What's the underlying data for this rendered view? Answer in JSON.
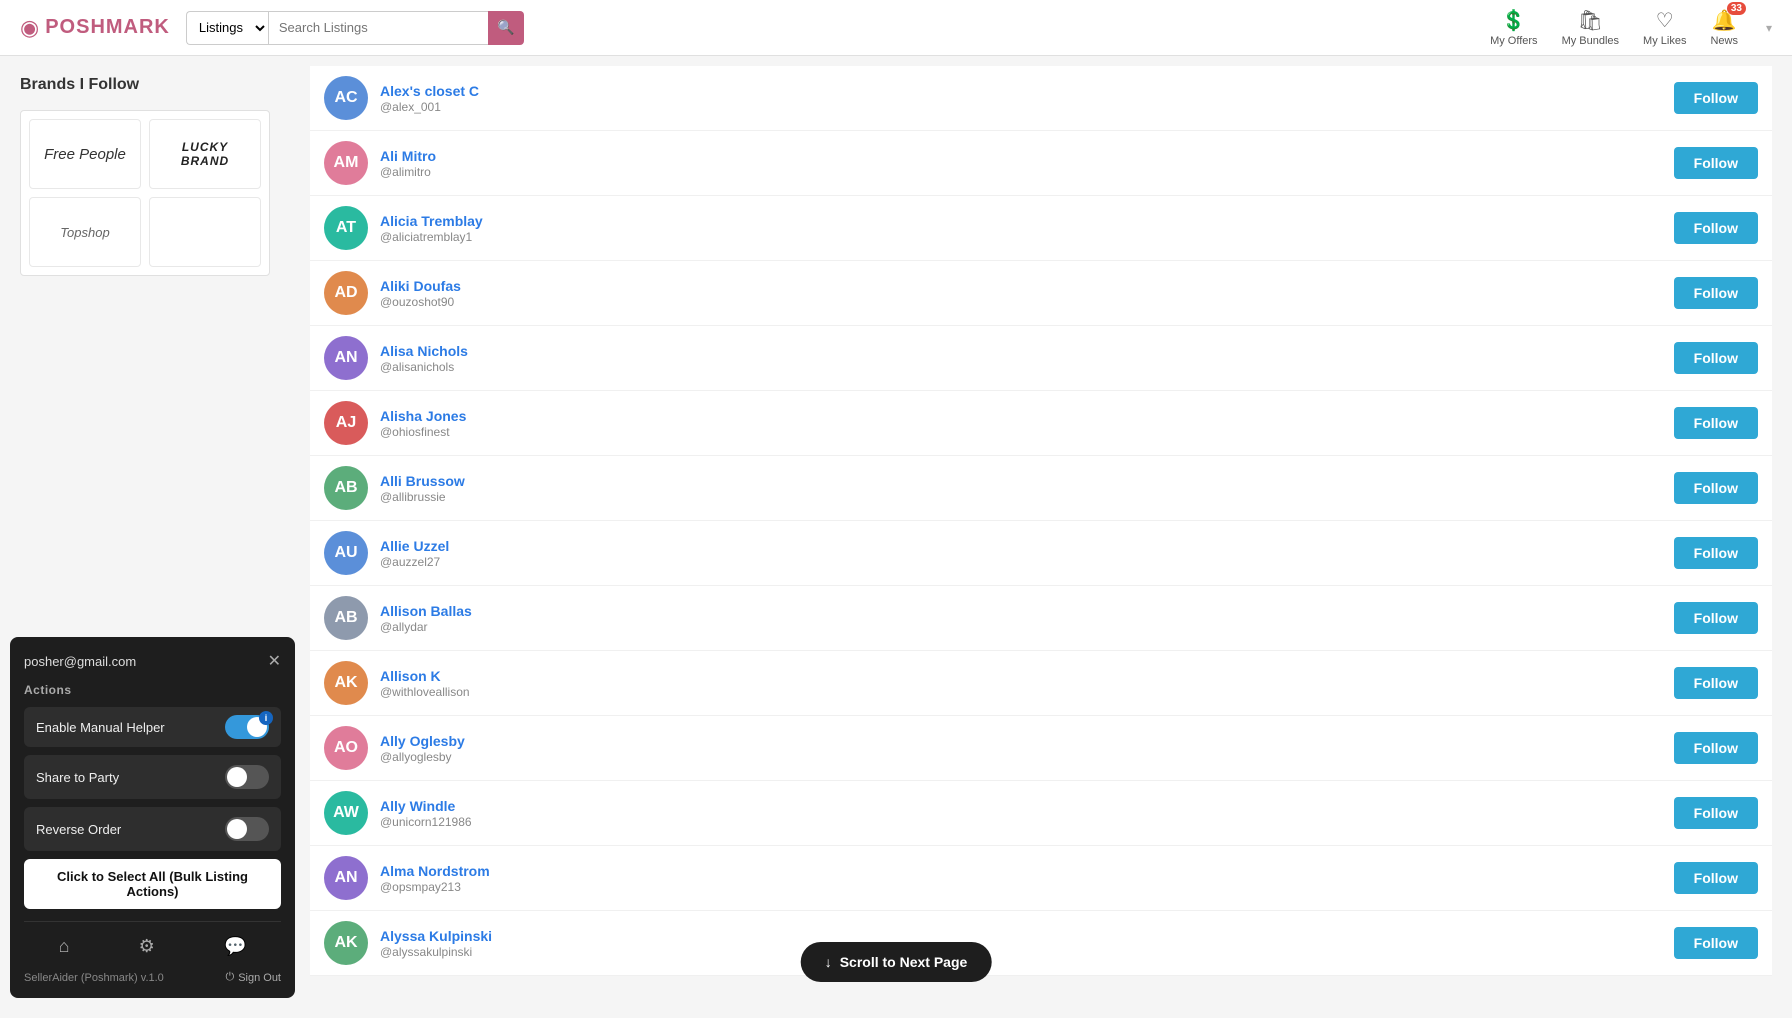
{
  "header": {
    "logo_text": "POSHMARK",
    "search_placeholder": "Search Listings",
    "search_dropdown": "Listings",
    "nav_items": [
      {
        "id": "my-offers",
        "icon": "💲",
        "label": "My Offers",
        "badge": null
      },
      {
        "id": "my-bundles",
        "icon": "🛍",
        "label": "My Bundles",
        "badge": null
      },
      {
        "id": "my-likes",
        "icon": "♡",
        "label": "My Likes",
        "badge": null
      },
      {
        "id": "news",
        "icon": "🔔",
        "label": "News",
        "badge": "33"
      }
    ]
  },
  "sidebar": {
    "title": "Brands I Follow",
    "brands": [
      {
        "id": "free-people",
        "name": "Free People",
        "style": "italic"
      },
      {
        "id": "lucky-brand",
        "name": "LUCKY\nBRAND",
        "style": "bold"
      },
      {
        "id": "topshop",
        "name": "Topshop",
        "style": "normal"
      },
      {
        "id": "empty",
        "name": "",
        "style": "empty"
      }
    ]
  },
  "widget": {
    "email": "posher@gmail.com",
    "actions_label": "Actions",
    "enable_manual_helper": "Enable Manual Helper",
    "manual_helper_on": true,
    "share_to_party": "Share to Party",
    "share_to_party_on": false,
    "reverse_order": "Reverse Order",
    "reverse_order_on": false,
    "bulk_select_label": "Click to Select All (Bulk Listing Actions)",
    "version": "SellerAider (Poshmark) v.1.0",
    "sign_out": "Sign Out"
  },
  "users": [
    {
      "id": 1,
      "name": "Alex's closet C",
      "handle": "@alex_001",
      "av_color": "av-blue",
      "av_initials": "AC"
    },
    {
      "id": 2,
      "name": "Ali Mitro",
      "handle": "@alimitro",
      "av_color": "av-pink",
      "av_initials": "AM"
    },
    {
      "id": 3,
      "name": "Alicia Tremblay",
      "handle": "@aliciatremblay1",
      "av_color": "av-teal",
      "av_initials": "AT"
    },
    {
      "id": 4,
      "name": "Aliki Doufas",
      "handle": "@ouzoshot90",
      "av_color": "av-orange",
      "av_initials": "AD"
    },
    {
      "id": 5,
      "name": "Alisa Nichols",
      "handle": "@alisanichols",
      "av_color": "av-purple",
      "av_initials": "AN"
    },
    {
      "id": 6,
      "name": "Alisha Jones",
      "handle": "@ohiosfinest",
      "av_color": "av-red",
      "av_initials": "AJ"
    },
    {
      "id": 7,
      "name": "Alli Brussow",
      "handle": "@allibrussie",
      "av_color": "av-green",
      "av_initials": "AB"
    },
    {
      "id": 8,
      "name": "Allie Uzzel",
      "handle": "@auzzel27",
      "av_color": "av-blue",
      "av_initials": "AU"
    },
    {
      "id": 9,
      "name": "Allison Ballas",
      "handle": "@allydar",
      "av_color": "av-gray",
      "av_initials": "AB"
    },
    {
      "id": 10,
      "name": "Allison K",
      "handle": "@withloveallison",
      "av_color": "av-orange",
      "av_initials": "AK"
    },
    {
      "id": 11,
      "name": "Ally Oglesby",
      "handle": "@allyoglesby",
      "av_color": "av-pink",
      "av_initials": "AO"
    },
    {
      "id": 12,
      "name": "Ally Windle",
      "handle": "@unicorn121986",
      "av_color": "av-teal",
      "av_initials": "AW"
    },
    {
      "id": 13,
      "name": "Alma Nordstrom",
      "handle": "@opsmpay213",
      "av_color": "av-purple",
      "av_initials": "AN"
    },
    {
      "id": 14,
      "name": "Alyssa Kulpinski",
      "handle": "@alyssakulpinski",
      "av_color": "av-green",
      "av_initials": "AK"
    }
  ],
  "follow_btn_label": "Follow",
  "scroll_next_label": "Scroll to Next Page"
}
